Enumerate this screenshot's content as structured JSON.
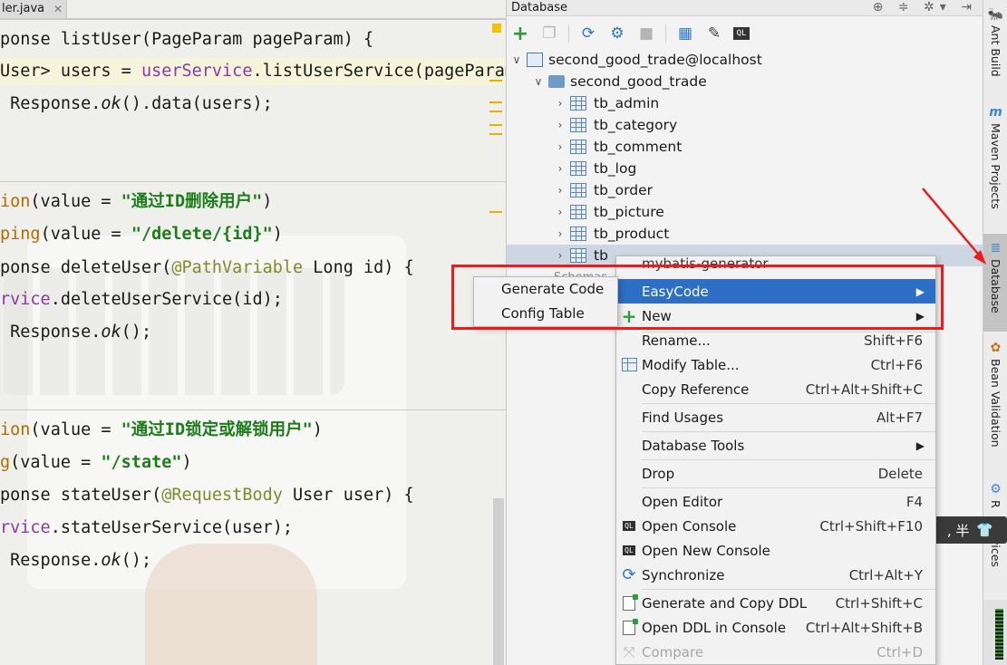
{
  "editor": {
    "tab_label": "ler.java",
    "tab_close": "✕",
    "lines": {
      "l1": [
        "ponse listUser(PageParam pageParam) {"
      ],
      "l2": {
        "a": "User> users = ",
        "b": "userService",
        "c": ".listUserService(pageParam"
      },
      "l3": {
        "a": " Response.",
        "b": "ok",
        "c": "().data(users);"
      },
      "l4": {
        "a": "ion",
        "b": "(value = ",
        "c": "\"通过ID删除用户\"",
        "d": ")"
      },
      "l5": {
        "a": "ping",
        "b": "(value = ",
        "c": "\"/delete/{id}\"",
        "d": ")"
      },
      "l6": {
        "a": "ponse deleteUser(",
        "b": "@PathVariable",
        "c": " Long id) {"
      },
      "l7": {
        "a": "rvice",
        "b": ".deleteUserService(id);"
      },
      "l8": {
        "a": " Response.",
        "b": "ok",
        "c": "();"
      },
      "l9": {
        "a": "ion",
        "b": "(value = ",
        "c": "\"通过ID锁定或解锁用户\"",
        "d": ")"
      },
      "l10": {
        "a": "g",
        "b": "(value = ",
        "c": "\"/state\"",
        "d": ")"
      },
      "l11": {
        "a": "ponse stateUser(",
        "b": "@RequestBody",
        "c": " User user) {"
      },
      "l12": {
        "a": "rvice",
        "b": ".stateUserService(user);"
      },
      "l13": {
        "a": " Response.",
        "b": "ok",
        "c": "();"
      }
    }
  },
  "database_panel": {
    "title": "Database",
    "title_icons": "⊕ ≑ ✲▾ ⇥",
    "toolbar": [
      "add-icon",
      "copy-icon",
      "refresh-icon",
      "properties-icon",
      "stop-icon",
      "table-icon",
      "edit-icon",
      "console-icon"
    ],
    "tree": {
      "connection": "second_good_trade@localhost",
      "schema": "second_good_trade",
      "tables": [
        "tb_admin",
        "tb_category",
        "tb_comment",
        "tb_log",
        "tb_order",
        "tb_picture",
        "tb_product",
        "tb"
      ],
      "schemas_label": "Schemas"
    }
  },
  "context_menu": {
    "top_partial": "mybatis-generator",
    "items": [
      {
        "label": "EasyCode",
        "shortcut": "",
        "submenu": true,
        "active": true
      },
      {
        "label": "New",
        "shortcut": "",
        "submenu": true
      },
      {
        "label": "Rename...",
        "shortcut": "Shift+F6"
      },
      {
        "label": "Modify Table...",
        "shortcut": "Ctrl+F6"
      },
      {
        "label": "Copy Reference",
        "shortcut": "Ctrl+Alt+Shift+C"
      },
      {
        "label": "Find Usages",
        "shortcut": "Alt+F7"
      },
      {
        "label": "Database Tools",
        "shortcut": "",
        "submenu": true
      },
      {
        "label": "Drop",
        "shortcut": "Delete"
      },
      {
        "label": "Open Editor",
        "shortcut": "F4"
      },
      {
        "label": "Open Console",
        "shortcut": "Ctrl+Shift+F10"
      },
      {
        "label": "Open New Console",
        "shortcut": ""
      },
      {
        "label": "Synchronize",
        "shortcut": "Ctrl+Alt+Y"
      },
      {
        "label": "Generate and Copy DDL",
        "shortcut": "Ctrl+Shift+C"
      },
      {
        "label": "Open DDL in Console",
        "shortcut": "Ctrl+Alt+Shift+B"
      },
      {
        "label": "Compare",
        "shortcut": "Ctrl+D",
        "disabled": true
      }
    ]
  },
  "submenu": {
    "items": [
      "Generate Code",
      "Config Table"
    ]
  },
  "tool_strip": {
    "tabs": [
      "Ant Build",
      "Maven Projects",
      "Database",
      "Bean Validation",
      "R",
      "vices"
    ],
    "active": "Database"
  },
  "ime": {
    "text": ", 半"
  },
  "colors": {
    "highlight": "#2e6fc6",
    "annotation": "#ec1c1c",
    "string": "#1d7d1a",
    "field": "#8a3aa8"
  }
}
